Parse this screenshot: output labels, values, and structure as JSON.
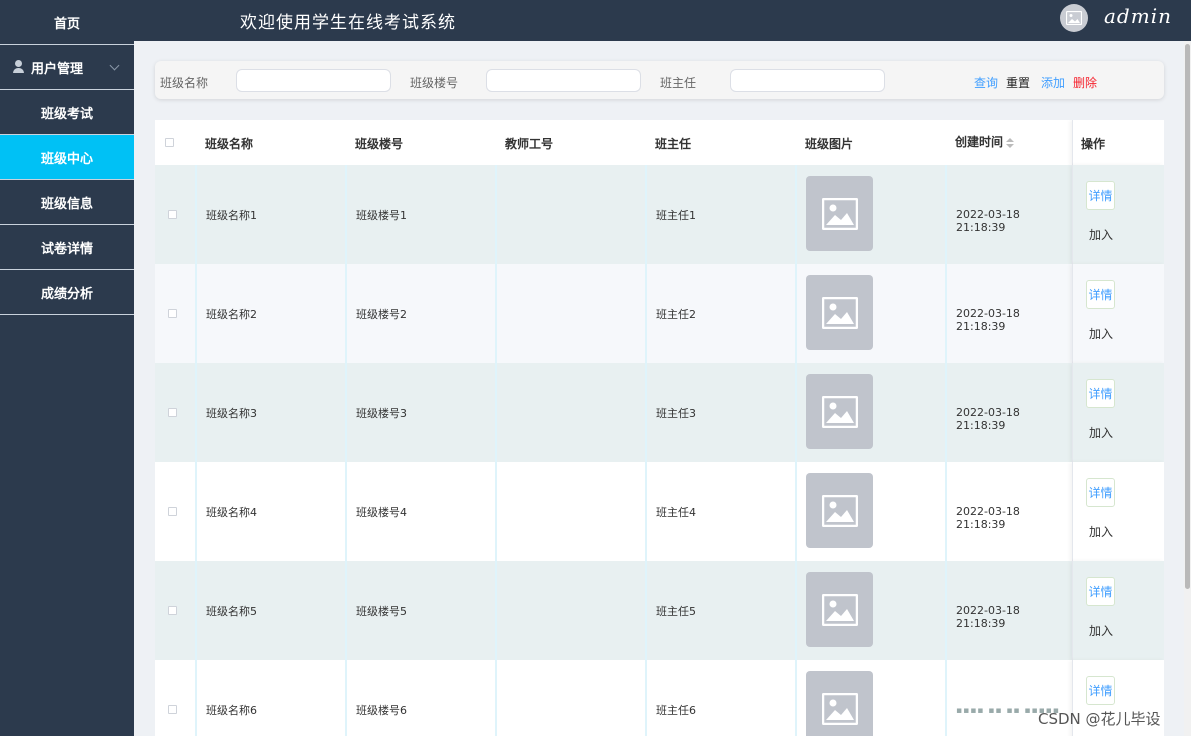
{
  "app": {
    "title": "欢迎使用学生在线考试系统",
    "username": "admin"
  },
  "sidebar": {
    "home": "首页",
    "group_label": "用户管理",
    "items": [
      {
        "label": "班级考试",
        "active": false
      },
      {
        "label": "班级中心",
        "active": true
      },
      {
        "label": "班级信息",
        "active": false
      },
      {
        "label": "试卷详情",
        "active": false
      },
      {
        "label": "成绩分析",
        "active": false
      }
    ]
  },
  "search": {
    "class_name_label": "班级名称",
    "class_name_value": "",
    "building_label": "班级楼号",
    "building_value": "",
    "teacher_label": "班主任",
    "teacher_value": "",
    "query": "查询",
    "reset": "重置",
    "add": "添加",
    "delete": "删除"
  },
  "table": {
    "headers": {
      "class_name": "班级名称",
      "building": "班级楼号",
      "teacher_id": "教师工号",
      "head_teacher": "班主任",
      "picture": "班级图片",
      "created": "创建时间",
      "ops": "操作"
    },
    "rows": [
      {
        "class_name": "班级名称1",
        "building": "班级楼号1",
        "teacher_id": "",
        "head_teacher": "班主任1",
        "created": "2022-03-18 21:18:39",
        "detail": "详情",
        "join": "加入"
      },
      {
        "class_name": "班级名称2",
        "building": "班级楼号2",
        "teacher_id": "",
        "head_teacher": "班主任2",
        "created": "2022-03-18 21:18:39",
        "detail": "详情",
        "join": "加入"
      },
      {
        "class_name": "班级名称3",
        "building": "班级楼号3",
        "teacher_id": "",
        "head_teacher": "班主任3",
        "created": "2022-03-18 21:18:39",
        "detail": "详情",
        "join": "加入"
      },
      {
        "class_name": "班级名称4",
        "building": "班级楼号4",
        "teacher_id": "",
        "head_teacher": "班主任4",
        "created": "2022-03-18 21:18:39",
        "detail": "详情",
        "join": "加入"
      },
      {
        "class_name": "班级名称5",
        "building": "班级楼号5",
        "teacher_id": "",
        "head_teacher": "班主任5",
        "created": "2022-03-18 21:18:39",
        "detail": "详情",
        "join": "加入"
      },
      {
        "class_name": "班级名称6",
        "building": "班级楼号6",
        "teacher_id": "",
        "head_teacher": "班主任6",
        "created": "",
        "detail": "详情",
        "join": ""
      }
    ]
  },
  "watermark": "CSDN @花儿毕设",
  "colors": {
    "sidebar_bg": "#2c3a4d",
    "active_nav": "#00c1f5",
    "link_blue": "#409eff",
    "delete_red": "#f5222d",
    "row_tint": "#e8f0f1",
    "row_alt": "#f6f8fb"
  }
}
